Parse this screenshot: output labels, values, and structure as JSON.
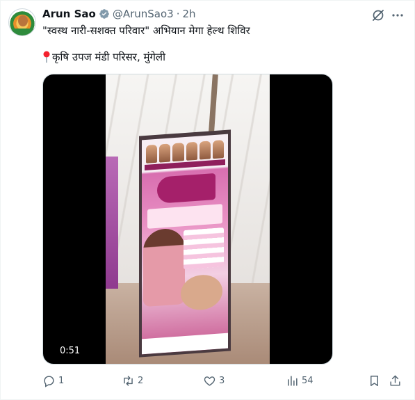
{
  "tweet": {
    "author_name": "Arun Sao",
    "handle": "@ArunSao3",
    "separator": "·",
    "time": "2h",
    "text_line1": "\"स्वस्थ नारी-सशक्त परिवार\" अभियान मेगा हेल्थ शिविर",
    "text_line2": "कृषि उपज मंडी परिसर, मुंगेली",
    "pin_icon": "round-pushpin-icon",
    "verified_color": "#829aab"
  },
  "media": {
    "duration": "0:51"
  },
  "actions": {
    "reply_count": "1",
    "retweet_count": "2",
    "like_count": "3",
    "views_count": "54"
  },
  "colors": {
    "text": "#0f1419",
    "muted": "#536471",
    "pin": "#f4212e"
  }
}
